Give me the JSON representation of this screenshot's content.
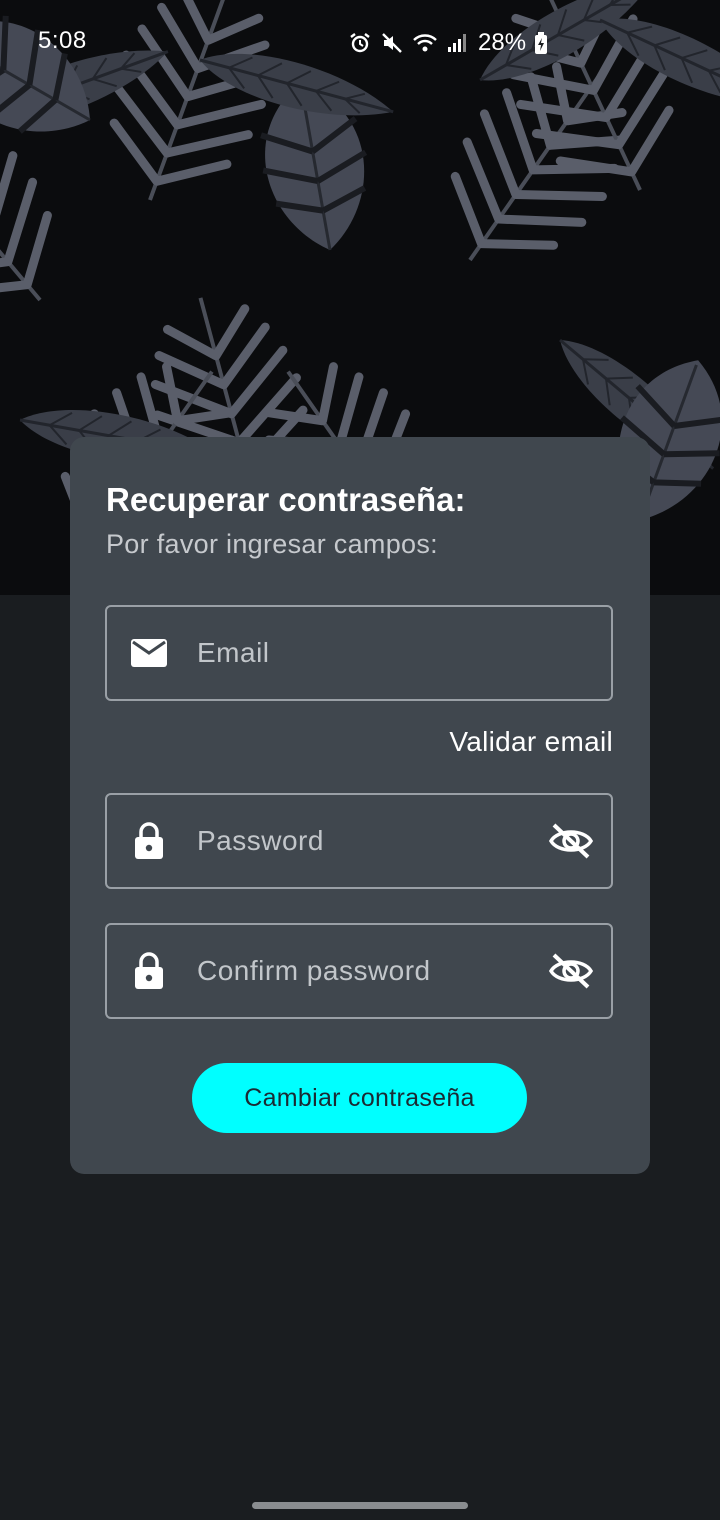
{
  "status_bar": {
    "time": "5:08",
    "battery_percent": "28%",
    "icons": [
      "alarm-icon",
      "mute-icon",
      "wifi-icon",
      "signal-icon",
      "battery-charging-icon"
    ]
  },
  "form": {
    "title": "Recuperar contraseña:",
    "subtitle": "Por favor ingresar campos:",
    "email": {
      "placeholder": "Email",
      "value": "",
      "icon": "email-icon"
    },
    "validate_link": "Validar email",
    "password": {
      "placeholder": "Password",
      "value": "",
      "icon": "lock-icon",
      "toggle_icon": "visibility-off-icon"
    },
    "confirm_password": {
      "placeholder": "Confirm password",
      "value": "",
      "icon": "lock-icon",
      "toggle_icon": "visibility-off-icon"
    },
    "submit_label": "Cambiar contraseña"
  },
  "colors": {
    "card_background": "#40474e",
    "page_background": "#1a1d20",
    "accent": "#00ffff",
    "field_border": "#9aa0a6"
  }
}
